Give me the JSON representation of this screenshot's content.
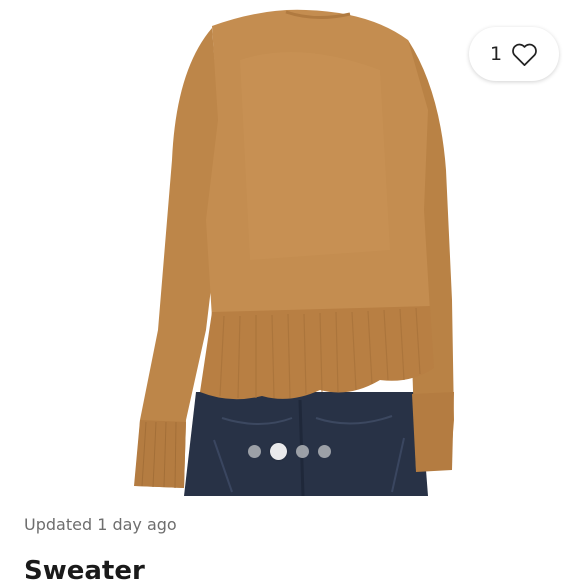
{
  "listing": {
    "like_count": "1",
    "updated_text": "Updated 1 day ago",
    "title": "Sweater"
  },
  "gallery": {
    "image_count": 4,
    "active_index": 1
  },
  "icons": {
    "like": "heart-outline-icon"
  },
  "colors": {
    "sweater": "#c08a4e",
    "jeans": "#2a3346",
    "dot_inactive": "#a9acb1"
  }
}
